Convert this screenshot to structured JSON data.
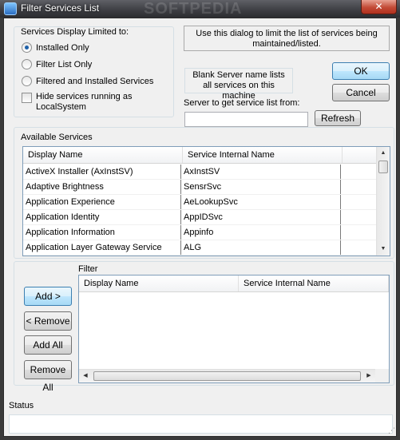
{
  "window": {
    "title": "Filter Services List",
    "close_glyph": "✕",
    "watermark": "SOFTPEDIA"
  },
  "display_group": {
    "label": "Services Display Limited to:",
    "options": [
      {
        "label": "Installed Only",
        "selected": true
      },
      {
        "label": "Filter List Only",
        "selected": false
      },
      {
        "label": "Filtered and Installed Services",
        "selected": false
      }
    ],
    "hide_local_system": {
      "label": "Hide services running as LocalSystem",
      "checked": false
    }
  },
  "info_text": "Use this dialog to limit the list of services being maintained/listed.",
  "blank_server_note": "Blank Server name lists all services on this machine",
  "server": {
    "label": "Server to get service list from:",
    "value": "",
    "refresh_label": "Refresh"
  },
  "buttons": {
    "ok": "OK",
    "cancel": "Cancel"
  },
  "available": {
    "label": "Available Services",
    "columns": [
      "Display Name",
      "Service Internal Name"
    ],
    "rows": [
      [
        "ActiveX Installer (AxInstSV)",
        "AxInstSV"
      ],
      [
        "Adaptive Brightness",
        "SensrSvc"
      ],
      [
        "Application Experience",
        "AeLookupSvc"
      ],
      [
        "Application Identity",
        "AppIDSvc"
      ],
      [
        "Application Information",
        "Appinfo"
      ],
      [
        "Application Layer Gateway Service",
        "ALG"
      ]
    ]
  },
  "filter": {
    "label": "Filter",
    "columns": [
      "Display Name",
      "Service Internal Name"
    ],
    "add": "Add >",
    "remove": "< Remove",
    "add_all": "Add All",
    "remove_all": "Remove All"
  },
  "status": {
    "label": "Status",
    "value": ""
  }
}
